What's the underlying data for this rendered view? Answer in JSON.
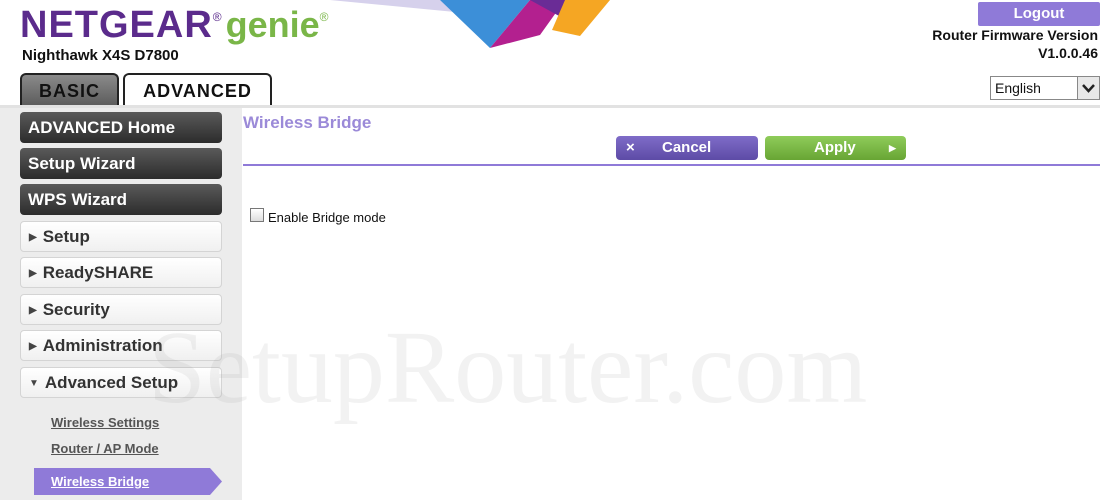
{
  "header": {
    "brand": "NETGEAR",
    "brand_mark": "®",
    "product": "genie",
    "product_mark": "®",
    "model": "Nighthawk X4S D7800",
    "logout_label": "Logout",
    "firmware_label": "Router Firmware Version",
    "firmware_version": "V1.0.0.46",
    "language": "English"
  },
  "tabs": [
    {
      "label": "BASIC"
    },
    {
      "label": "ADVANCED"
    }
  ],
  "sidebar": {
    "items": [
      {
        "label": "ADVANCED Home"
      },
      {
        "label": "Setup Wizard"
      },
      {
        "label": "WPS Wizard"
      },
      {
        "label": "Setup",
        "arrow": "▶"
      },
      {
        "label": "ReadySHARE",
        "arrow": "▶"
      },
      {
        "label": "Security",
        "arrow": "▶"
      },
      {
        "label": "Administration",
        "arrow": "▶"
      },
      {
        "label": "Advanced Setup",
        "arrow": "▼"
      }
    ],
    "subitems": [
      {
        "label": "Wireless Settings"
      },
      {
        "label": "Router / AP Mode"
      },
      {
        "label": "Wireless Bridge"
      }
    ]
  },
  "main": {
    "title": "Wireless Bridge",
    "cancel_icon": "×",
    "cancel_label": "Cancel",
    "apply_label": "Apply",
    "apply_icon": "▶",
    "checkbox_label": "Enable Bridge mode",
    "checkbox_checked": false
  },
  "watermark": "SetupRouter.com",
  "colors": {
    "brand_purple": "#5b2b8c",
    "genie_green": "#7ab648",
    "accent_purple": "#8f7ad8",
    "apply_green": "#68a534"
  }
}
